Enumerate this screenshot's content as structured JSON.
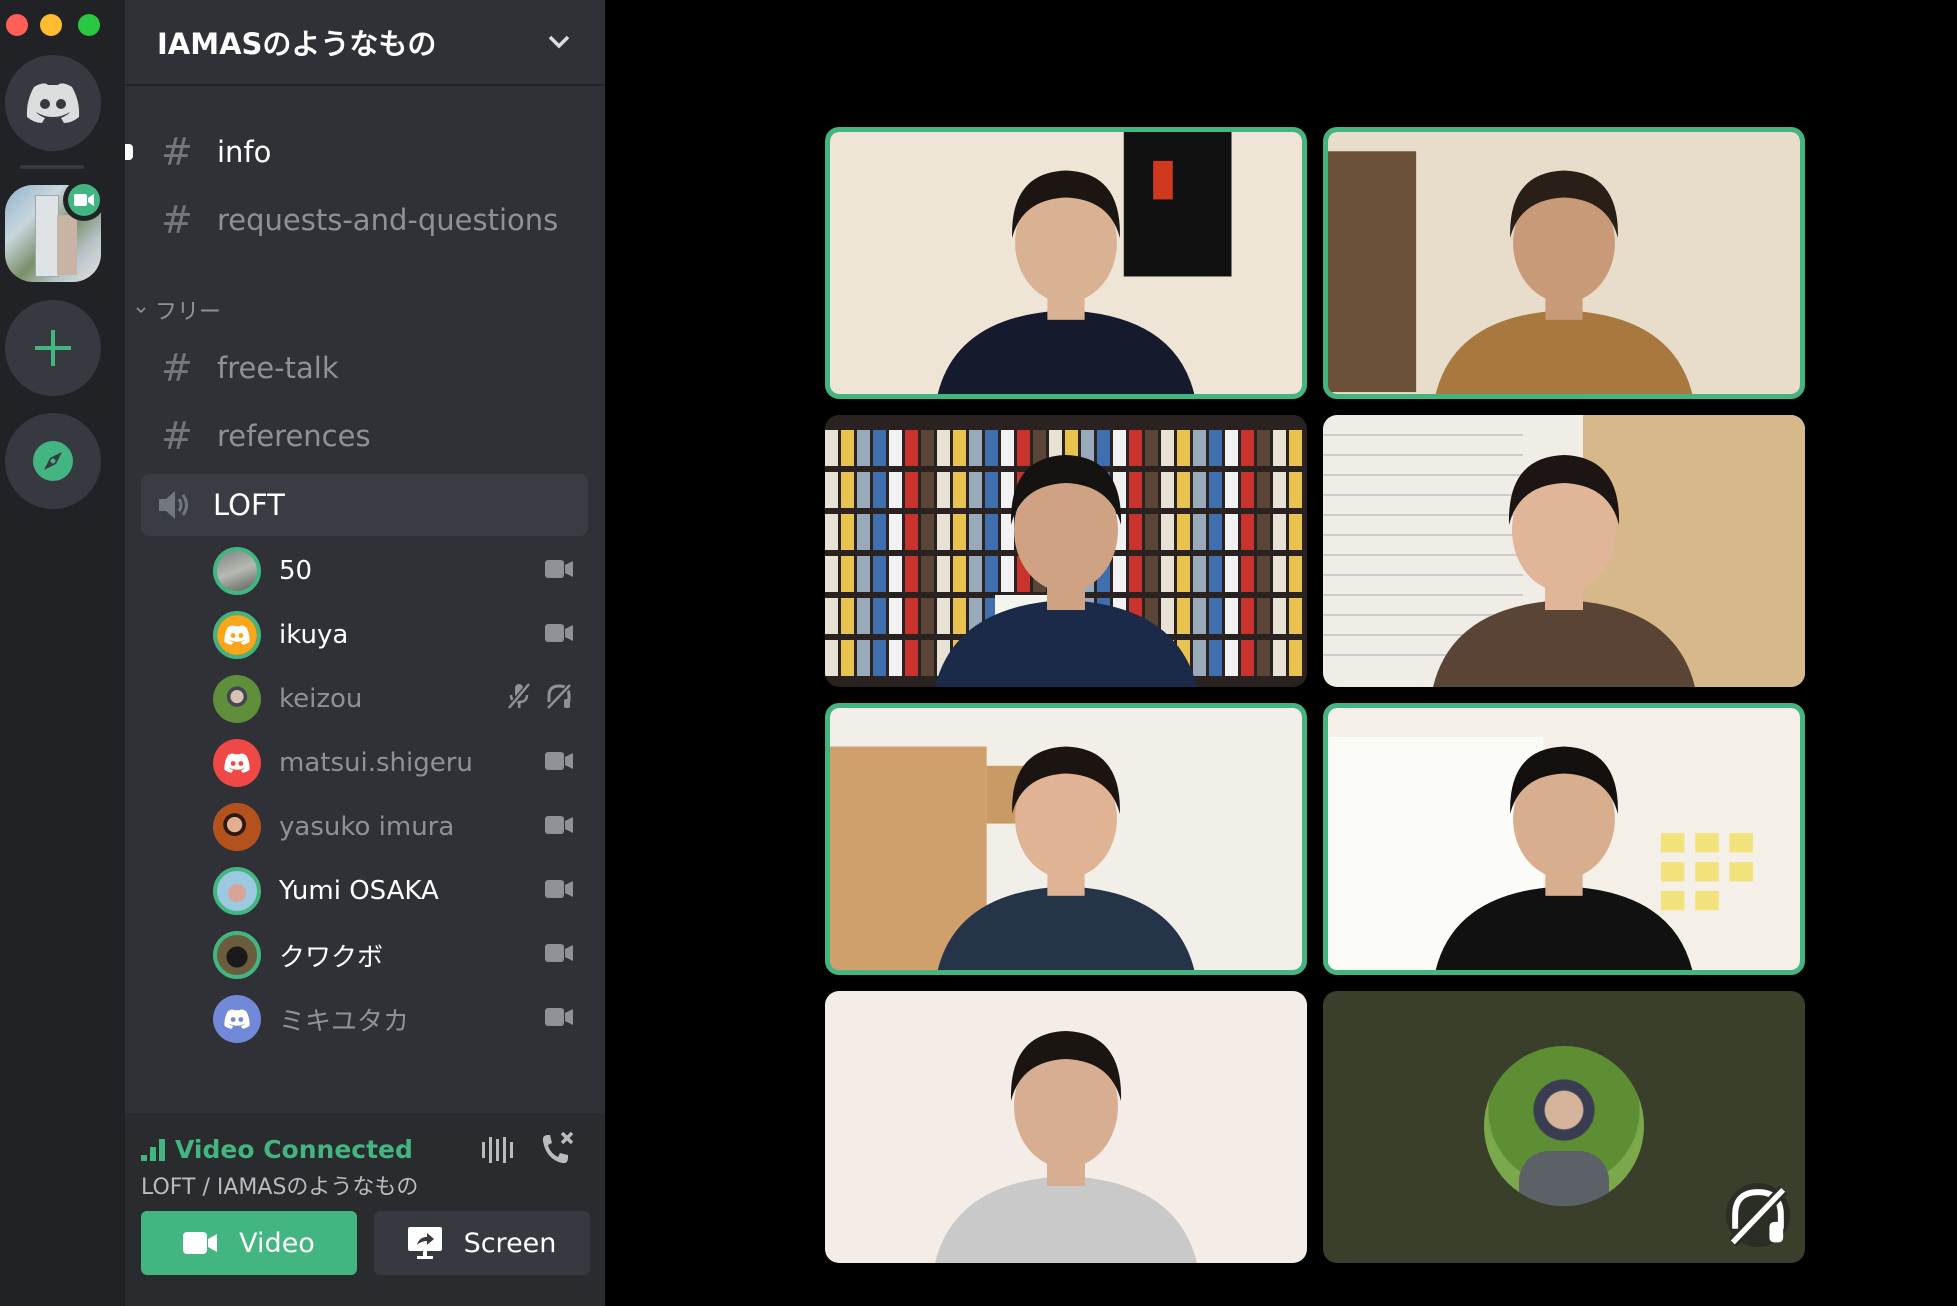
{
  "window": {
    "traffic_lights": [
      {
        "name": "close",
        "color": "#ff5f57"
      },
      {
        "name": "minimize",
        "color": "#febc2e"
      },
      {
        "name": "maximize",
        "color": "#28c840"
      }
    ]
  },
  "colors": {
    "accent": "#43b581",
    "rail_bg": "#202225",
    "sidebar_bg": "#2f3136",
    "panel_bg": "#292b2f",
    "blurple": "#7289da",
    "red": "#f04747",
    "orange": "#faa61a"
  },
  "server_rail": {
    "home_icon": "discord-logo-icon",
    "active_server": {
      "name": "IAMASのようなもの",
      "badge_icon": "video-camera-icon"
    },
    "add_icon": "plus-icon",
    "explore_icon": "compass-icon"
  },
  "guild": {
    "name": "IAMASのようなもの",
    "menu_icon": "chevron-down-icon"
  },
  "channels": [
    {
      "type": "text",
      "name": "info",
      "unread": true
    },
    {
      "type": "text",
      "name": "requests-and-questions",
      "unread": false
    }
  ],
  "categories": [
    {
      "name": "フリー",
      "channels": [
        {
          "type": "text",
          "name": "free-talk"
        },
        {
          "type": "text",
          "name": "references"
        },
        {
          "type": "voice",
          "name": "LOFT",
          "active": true
        }
      ]
    }
  ],
  "voice_users": [
    {
      "name": "50",
      "speaking": true,
      "live": true,
      "avatar": "photo",
      "status_icons": [
        "video-icon"
      ]
    },
    {
      "name": "ikuya",
      "speaking": true,
      "live": true,
      "avatar": "discord-orange",
      "status_icons": [
        "video-icon"
      ]
    },
    {
      "name": "keizou",
      "speaking": false,
      "live": false,
      "avatar": "photo",
      "status_icons": [
        "mic-muted-icon",
        "headphones-deafened-icon"
      ]
    },
    {
      "name": "matsui.shigeru",
      "speaking": false,
      "live": false,
      "avatar": "discord-red",
      "status_icons": [
        "video-icon"
      ]
    },
    {
      "name": "yasuko imura",
      "speaking": false,
      "live": false,
      "avatar": "photo",
      "status_icons": [
        "video-icon"
      ]
    },
    {
      "name": "Yumi OSAKA",
      "speaking": true,
      "live": true,
      "avatar": "photo",
      "status_icons": [
        "video-icon"
      ]
    },
    {
      "name": "クワクボ",
      "speaking": true,
      "live": true,
      "avatar": "photo",
      "status_icons": [
        "video-icon"
      ]
    },
    {
      "name": "ミキユタカ",
      "speaking": false,
      "live": false,
      "avatar": "discord-blurple",
      "status_icons": [
        "video-icon"
      ]
    }
  ],
  "voice_panel": {
    "status": "Video Connected",
    "location": "LOFT / IAMASのようなもの",
    "video_label": "Video",
    "screen_label": "Screen",
    "noise_icon": "noise-suppression-icon",
    "disconnect_icon": "disconnect-call-icon"
  },
  "video_tiles": [
    {
      "participant": "man with long hair, dark sweater",
      "speaking": true,
      "kind": "video"
    },
    {
      "participant": "man in tan shirt",
      "speaking": true,
      "kind": "video"
    },
    {
      "participant": "man with glasses holding book, bookshelf",
      "speaking": false,
      "kind": "video"
    },
    {
      "participant": "woman with earphones, curtains",
      "speaking": false,
      "kind": "video"
    },
    {
      "participant": "woman smiling, wooden cabinets",
      "speaking": true,
      "kind": "video"
    },
    {
      "participant": "man smiling, sticky notes",
      "speaking": true,
      "kind": "video"
    },
    {
      "participant": "young man in grey t-shirt",
      "speaking": false,
      "kind": "video"
    },
    {
      "participant": "keizou",
      "speaking": false,
      "kind": "avatar",
      "tile_bg": "#3a3f2c",
      "status_icon": "headphones-deafened-icon"
    }
  ]
}
